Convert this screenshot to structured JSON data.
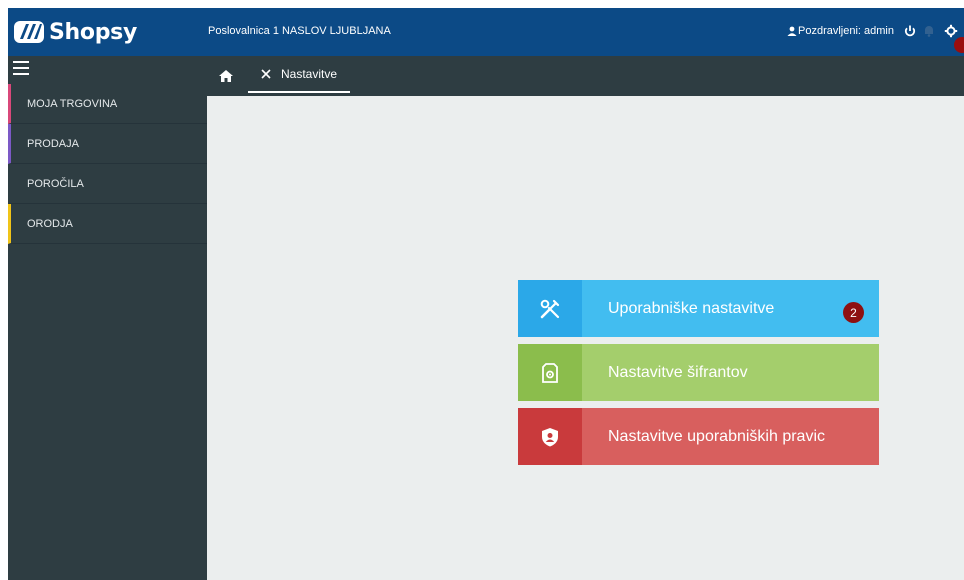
{
  "header": {
    "logo_text": "Shopsy",
    "branch": "Poslovalnica 1 NASLOV LJUBLJANA",
    "user_text": "Pozdravljeni: admin"
  },
  "sidebar": {
    "items": [
      {
        "label": "MOJA TRGOVINA",
        "accent": "#d9487a"
      },
      {
        "label": "PRODAJA",
        "accent": "#7c59c6"
      },
      {
        "label": "POROČILA",
        "accent": "#2e3d42"
      },
      {
        "label": "ORODJA",
        "accent": "#f0c419"
      }
    ]
  },
  "tabs": {
    "active_label": "Nastavitve"
  },
  "cards": [
    {
      "label": "Uporabniške nastavitve",
      "icon": "tools-icon",
      "badge": "2"
    },
    {
      "label": "Nastavitve šifrantov",
      "icon": "document-gear-icon"
    },
    {
      "label": "Nastavitve uporabniških pravic",
      "icon": "user-shield-icon"
    }
  ],
  "colors": {
    "header_bg": "#0c4a86",
    "sidebar_bg": "#2e3d42",
    "content_bg": "#ebeeee",
    "card_blue": "#42bdf0",
    "card_green": "#a4ce6c",
    "card_red": "#d85f5e"
  }
}
